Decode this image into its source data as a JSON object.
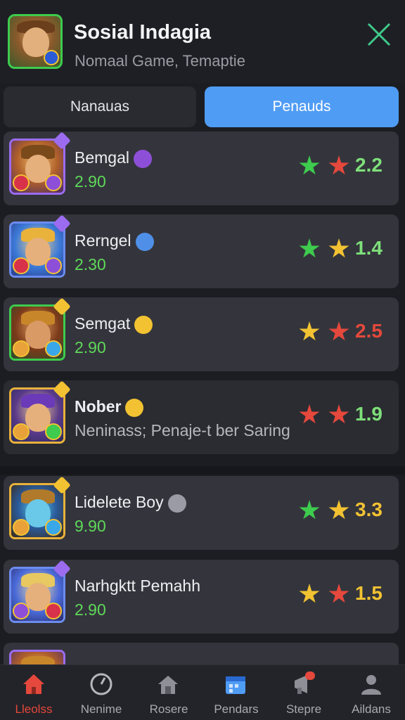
{
  "header": {
    "title": "Sosial Indagia",
    "subtitle": "Nomaal Game, Temaptie",
    "close_icon": "close-icon"
  },
  "tabs": [
    {
      "label": "Nanauas",
      "selected": false
    },
    {
      "label": "Penauds",
      "selected": true
    }
  ],
  "players": [
    {
      "name": "Bemgal",
      "value": "2.90",
      "rating": "2.2",
      "rating_color": "#7ee07a",
      "stars": [
        "#3ecb4e",
        "#e5483c"
      ],
      "frame": "purple",
      "emoji_color": "#8e4fd8"
    },
    {
      "name": "Rerngel",
      "value": "2.30",
      "rating": "1.4",
      "rating_color": "#7ee07a",
      "stars": [
        "#3ecb4e",
        "#f2c232"
      ],
      "frame": "blue",
      "emoji_color": "#4f8fe8"
    },
    {
      "name": "Semgat",
      "value": "2.90",
      "rating": "2.5",
      "rating_color": "#e5483c",
      "stars": [
        "#f2c232",
        "#e5483c"
      ],
      "frame": "green",
      "emoji_color": "#f2c232"
    },
    {
      "name": "Nober",
      "value": "Neninass; Penaje-t ber Saring",
      "rating": "1.9",
      "rating_color": "#7ee07a",
      "stars": [
        "#e5483c",
        "#e5483c"
      ],
      "frame": "gold",
      "emoji_color": "#f2c232"
    },
    {
      "name": "Lidelete Boy",
      "value": "9.90",
      "rating": "3.3",
      "rating_color": "#f2c232",
      "stars": [
        "#3ecb4e",
        "#f2c232"
      ],
      "frame": "gold",
      "emoji_color": "#9a9ba4"
    },
    {
      "name": "Narhgktt Pemahh",
      "value": "2.90",
      "rating": "1.5",
      "rating_color": "#f2c232",
      "stars": [
        "#f2c232",
        "#e5483c"
      ],
      "frame": "blue",
      "emoji_color": ""
    }
  ],
  "nav": [
    {
      "label": "Lleolss",
      "icon": "home-icon",
      "active": true
    },
    {
      "label": "Nenime",
      "icon": "compass-icon",
      "active": false
    },
    {
      "label": "Rosere",
      "icon": "house-notification-icon",
      "active": false
    },
    {
      "label": "Pendars",
      "icon": "calendar-icon",
      "active": false
    },
    {
      "label": "Stepre",
      "icon": "megaphone-icon",
      "active": false
    },
    {
      "label": "Aildans",
      "icon": "person-icon",
      "active": false
    }
  ],
  "colors": {
    "accent": "#4f9cf5",
    "background": "#1c1d22",
    "card": "#34353c",
    "active_nav": "#e5483c",
    "value_green": "#5fd85a"
  }
}
